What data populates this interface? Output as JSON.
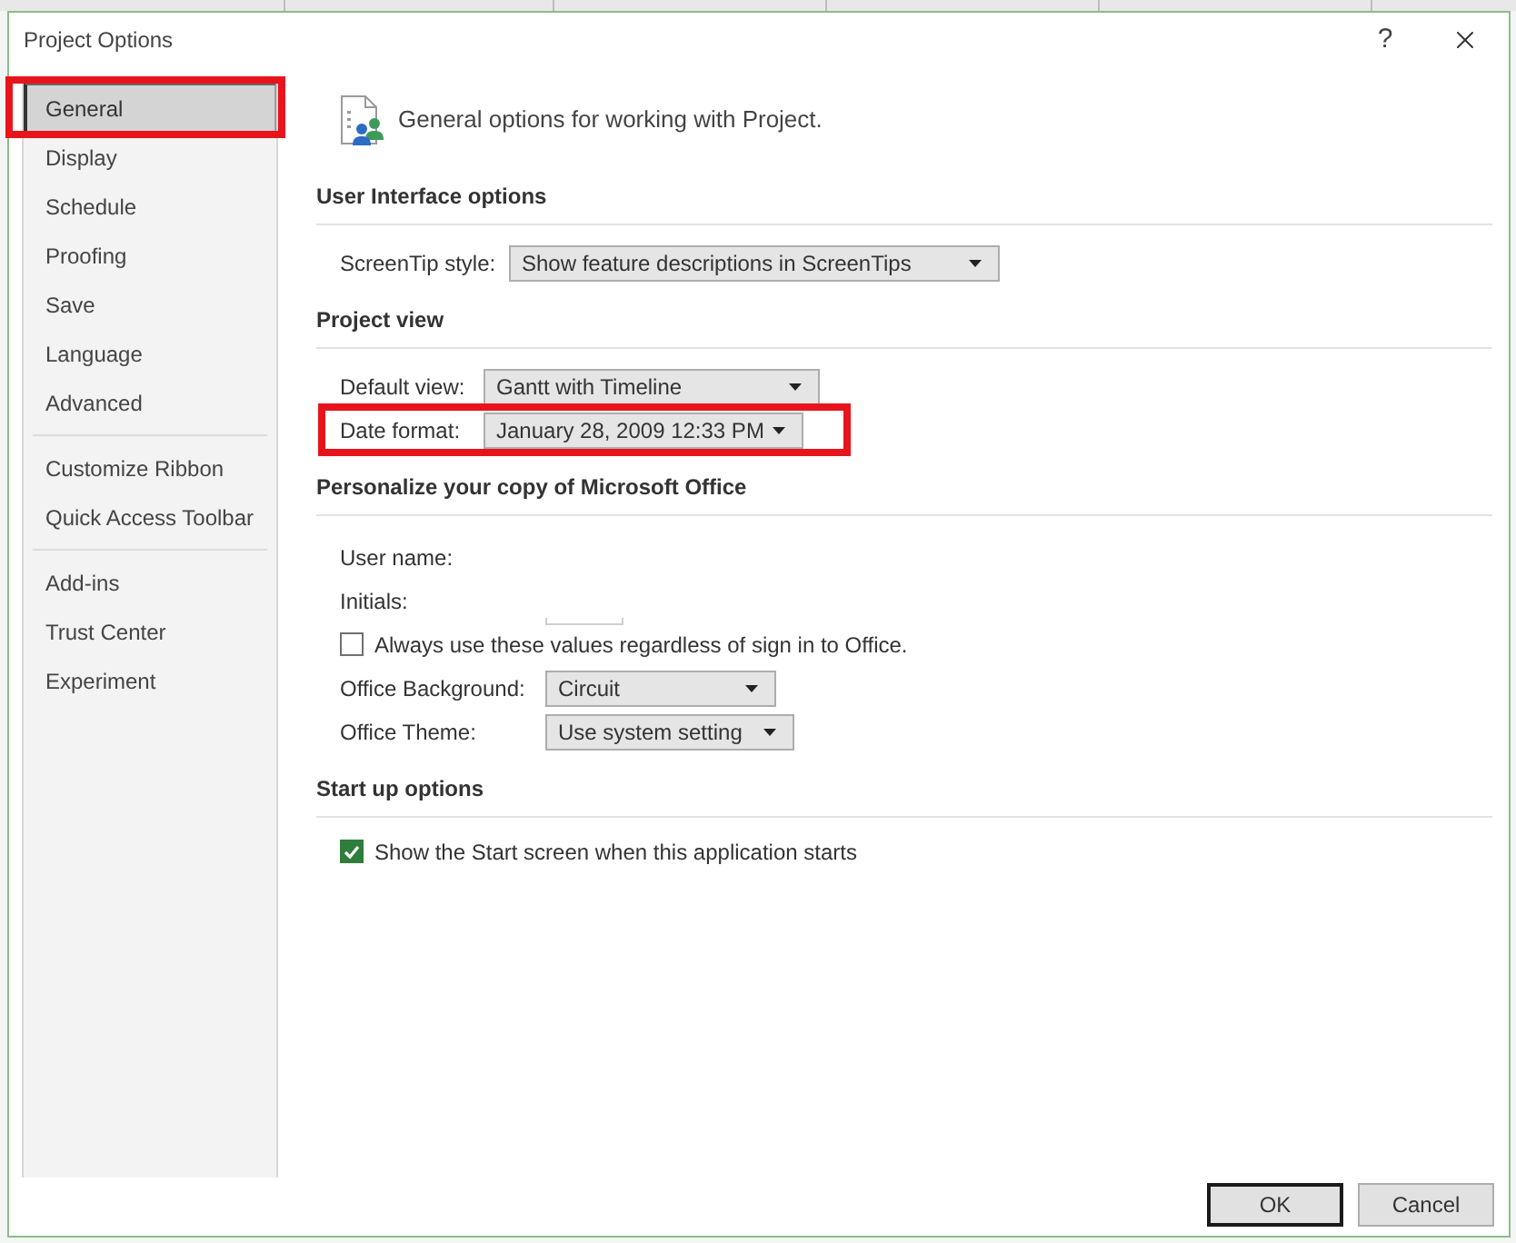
{
  "window": {
    "title": "Project Options",
    "help_button": "?"
  },
  "sidebar": {
    "groups": [
      [
        {
          "label": "General",
          "selected": true,
          "highlighted": true
        },
        {
          "label": "Display",
          "selected": false,
          "highlighted": false
        },
        {
          "label": "Schedule",
          "selected": false,
          "highlighted": false
        },
        {
          "label": "Proofing",
          "selected": false,
          "highlighted": false
        },
        {
          "label": "Save",
          "selected": false,
          "highlighted": false
        },
        {
          "label": "Language",
          "selected": false,
          "highlighted": false
        },
        {
          "label": "Advanced",
          "selected": false,
          "highlighted": false
        }
      ],
      [
        {
          "label": "Customize Ribbon",
          "selected": false,
          "highlighted": false
        },
        {
          "label": "Quick Access Toolbar",
          "selected": false,
          "highlighted": false
        }
      ],
      [
        {
          "label": "Add-ins",
          "selected": false,
          "highlighted": false
        },
        {
          "label": "Trust Center",
          "selected": false,
          "highlighted": false
        },
        {
          "label": "Experiment",
          "selected": false,
          "highlighted": false
        }
      ]
    ]
  },
  "header": {
    "text": "General options for working with Project."
  },
  "sections": [
    {
      "title": "User Interface options",
      "rows": [
        {
          "kind": "dropdown",
          "label": "ScreenTip style:",
          "value": "Show feature descriptions in ScreenTips",
          "highlighted": false
        }
      ]
    },
    {
      "title": "Project view",
      "rows": [
        {
          "kind": "dropdown",
          "label": "Default view:",
          "value": "Gantt with Timeline",
          "highlighted": false
        },
        {
          "kind": "dropdown",
          "label": "Date format:",
          "value": "January 28, 2009 12:33 PM",
          "highlighted": true
        }
      ]
    },
    {
      "title": "Personalize your copy of Microsoft Office",
      "rows": [
        {
          "kind": "label",
          "label": "User name:",
          "highlighted": false
        },
        {
          "kind": "textfield",
          "label": "Initials:",
          "highlighted": false
        },
        {
          "kind": "checkbox",
          "label": "Always use these values regardless of sign in to Office.",
          "checked": false,
          "highlighted": false
        },
        {
          "kind": "dropdown",
          "label": "Office Background:",
          "value": "Circuit",
          "highlighted": false
        },
        {
          "kind": "dropdown",
          "label": "Office Theme:",
          "value": "Use system setting",
          "highlighted": false
        }
      ]
    },
    {
      "title": "Start up options",
      "rows": [
        {
          "kind": "checkbox",
          "label": "Show the Start screen when this application starts",
          "checked": true,
          "highlighted": false
        }
      ]
    }
  ],
  "buttons": [
    {
      "label": "OK",
      "default": true
    },
    {
      "label": "Cancel",
      "default": false
    }
  ]
}
